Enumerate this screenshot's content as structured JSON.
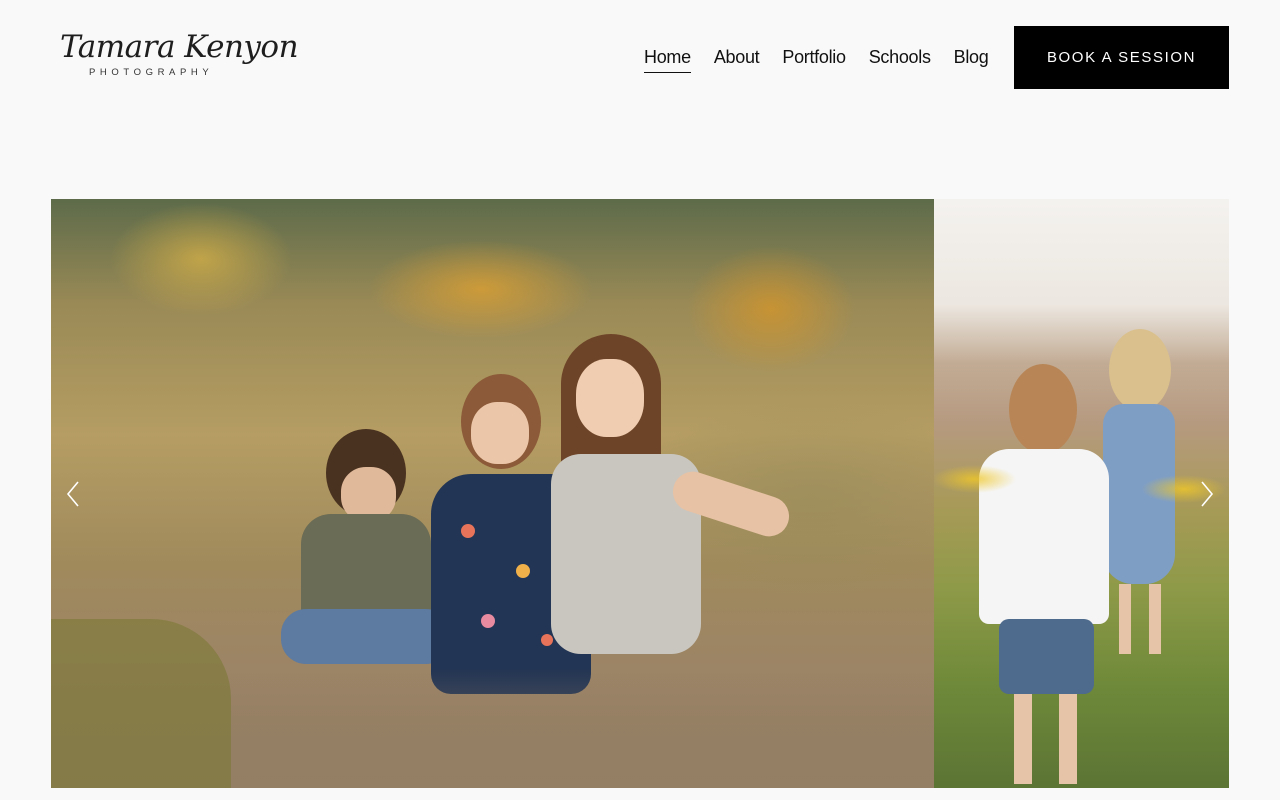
{
  "site": {
    "logo_script": "Tamara Kenyon",
    "logo_sub": "PHOTOGRAPHY"
  },
  "nav": {
    "items": [
      {
        "label": "Home",
        "active": true
      },
      {
        "label": "About",
        "active": false
      },
      {
        "label": "Portfolio",
        "active": false
      },
      {
        "label": "Schools",
        "active": false
      },
      {
        "label": "Blog",
        "active": false
      }
    ],
    "cta_label": "BOOK A SESSION"
  },
  "slideshow": {
    "slides": [
      {
        "photo": "three-children-laughing-in-wildflower-field"
      },
      {
        "photo": "two-children-walking-in-meadow"
      }
    ],
    "prev_icon": "chevron-left-icon",
    "next_icon": "chevron-right-icon"
  },
  "colors": {
    "background": "#f9f9f9",
    "cta_background": "#000000",
    "cta_text": "#ffffff",
    "nav_text": "#111111"
  }
}
